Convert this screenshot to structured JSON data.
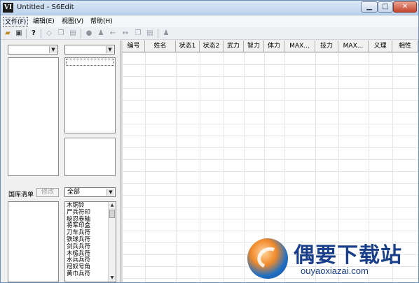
{
  "window": {
    "title": "Untitled - S6Edit",
    "app_icon": "VI",
    "minimize_glyph": "▁",
    "maximize_glyph": "□",
    "close_glyph": "✕"
  },
  "menu": [
    {
      "label": "文件(F)",
      "active": true
    },
    {
      "label": "编辑(E)"
    },
    {
      "label": "视图(V)"
    },
    {
      "label": "帮助(H)"
    }
  ],
  "toolbar": {
    "icons": [
      "open-folder-icon",
      "save-icon",
      "help-icon",
      "eraser-icon",
      "copy-icon",
      "paste-icon",
      "comment-icon",
      "person-icon",
      "arrow-left-icon",
      "arrow-both-icon",
      "copy-icon",
      "paste-icon",
      "person-icon"
    ]
  },
  "left_panel": {
    "top_combo_left_value": "",
    "top_combo_right_value": "",
    "library_label": "国库清单",
    "modify_button": "修改",
    "category_combo_value": "全部",
    "items": [
      "木铜铃",
      "尸兵符印",
      "秘忍卷轴",
      "将军印盒",
      "刀车兵符",
      "铁球兵符",
      "剑兵兵符",
      "木槌兵符",
      "水兵兵符",
      "冠奴号角",
      "黄巾兵符"
    ]
  },
  "grid": {
    "columns": [
      "编号",
      "姓名",
      "状态1",
      "状态2",
      "武力",
      "智力",
      "体力",
      "MAX...",
      "技力",
      "MAX...",
      "义理",
      "相性"
    ]
  },
  "watermark": {
    "title": "偶要下载站",
    "url": "ouyaoxiazai.com"
  }
}
